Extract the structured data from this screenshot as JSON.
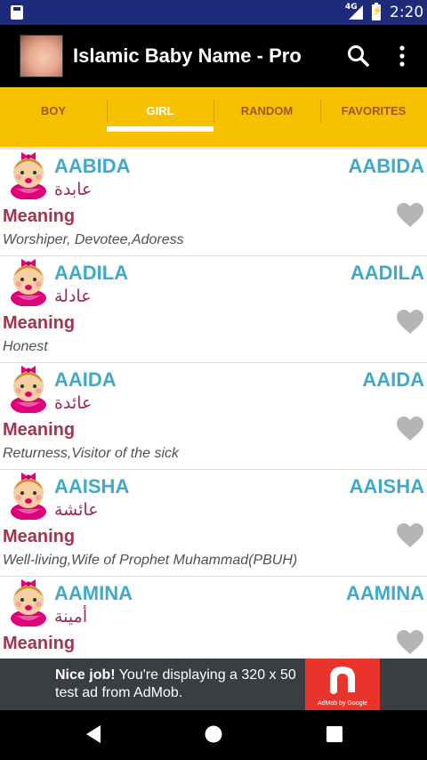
{
  "status_bar": {
    "network": "4G",
    "time": "2:20"
  },
  "app_bar": {
    "title": "Islamic Baby Name - Pro"
  },
  "tabs": [
    {
      "label": "BOY"
    },
    {
      "label": "GIRL"
    },
    {
      "label": "RANDOM"
    },
    {
      "label": "FAVORITES"
    }
  ],
  "active_tab": "GIRL",
  "names": [
    {
      "name": "AABIDA",
      "name_right": "AABIDA",
      "arabic": "عابدة",
      "meaning_label": "Meaning",
      "meaning": "Worshiper, Devotee,Adoress"
    },
    {
      "name": "AADILA",
      "name_right": "AADILA",
      "arabic": "عادلة",
      "meaning_label": "Meaning",
      "meaning": "Honest"
    },
    {
      "name": "AAIDA",
      "name_right": "AAIDA",
      "arabic": "عائدة",
      "meaning_label": "Meaning",
      "meaning": "Returness,Visitor of the sick"
    },
    {
      "name": "AAISHA",
      "name_right": "AAISHA",
      "arabic": "عائشة",
      "meaning_label": "Meaning",
      "meaning": "Well-living,Wife of Prophet Muhammad(PBUH)"
    },
    {
      "name": "AAMINA",
      "name_right": "AAMINA",
      "arabic": "أمينة",
      "meaning_label": "Meaning",
      "meaning": ""
    }
  ],
  "ad": {
    "headline": "Nice job!",
    "body": " You're displaying a 320 x 50 test ad from AdMob.",
    "brand": "AdMob by Google",
    "color": "#e8342b"
  },
  "colors": {
    "accent": "#f8c100",
    "name": "#3fa9c9",
    "meaning": "#a2344f",
    "status_bar": "#1e2a7a"
  },
  "icons": [
    "search-icon",
    "overflow-menu-icon",
    "heart-icon",
    "baby-girl-icon",
    "back-icon",
    "home-icon",
    "recents-icon"
  ]
}
